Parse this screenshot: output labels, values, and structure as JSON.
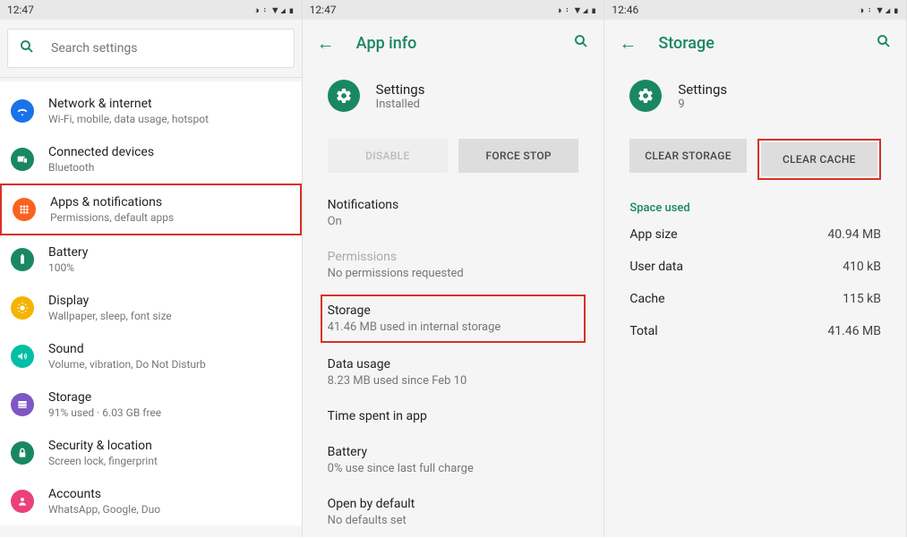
{
  "status": {
    "time1": "12:47",
    "time2": "12:47",
    "time3": "12:46",
    "icons": "◑ ᛬ ▼◢ ▮"
  },
  "panel1": {
    "search_placeholder": "Search settings",
    "items": [
      {
        "title": "Network & internet",
        "sub": "Wi-Fi, mobile, data usage, hotspot",
        "color": "#1a73e8",
        "icon": "wifi"
      },
      {
        "title": "Connected devices",
        "sub": "Bluetooth",
        "color": "#1a8763",
        "icon": "devices"
      },
      {
        "title": "Apps & notifications",
        "sub": "Permissions, default apps",
        "color": "#f9621f",
        "icon": "apps",
        "highlight": true
      },
      {
        "title": "Battery",
        "sub": "100%",
        "color": "#1a8763",
        "icon": "battery"
      },
      {
        "title": "Display",
        "sub": "Wallpaper, sleep, font size",
        "color": "#f4b400",
        "icon": "display"
      },
      {
        "title": "Sound",
        "sub": "Volume, vibration, Do Not Disturb",
        "color": "#00bfa5",
        "icon": "sound"
      },
      {
        "title": "Storage",
        "sub": "91% used · 6.03 GB free",
        "color": "#7e57c2",
        "icon": "storage"
      },
      {
        "title": "Security & location",
        "sub": "Screen lock, fingerprint",
        "color": "#1a8763",
        "icon": "lock"
      },
      {
        "title": "Accounts",
        "sub": "WhatsApp, Google, Duo",
        "color": "#ec407a",
        "icon": "accounts"
      }
    ]
  },
  "panel2": {
    "header": "App info",
    "app_name": "Settings",
    "app_status": "Installed",
    "btn_disable": "DISABLE",
    "btn_force": "FORCE STOP",
    "items": [
      {
        "title": "Notifications",
        "sub": "On"
      },
      {
        "title": "Permissions",
        "sub": "No permissions requested",
        "dim": true
      },
      {
        "title": "Storage",
        "sub": "41.46 MB used in internal storage",
        "highlight": true
      },
      {
        "title": "Data usage",
        "sub": "8.23 MB used since Feb 10"
      },
      {
        "title": "Time spent in app",
        "sub": ""
      },
      {
        "title": "Battery",
        "sub": "0% use since last full charge"
      },
      {
        "title": "Open by default",
        "sub": "No defaults set"
      }
    ]
  },
  "panel3": {
    "header": "Storage",
    "app_name": "Settings",
    "app_status": "9",
    "btn_clear_storage": "CLEAR STORAGE",
    "btn_clear_cache": "CLEAR CACHE",
    "section": "Space used",
    "rows": [
      {
        "k": "App size",
        "v": "40.94 MB"
      },
      {
        "k": "User data",
        "v": "410 kB"
      },
      {
        "k": "Cache",
        "v": "115 kB"
      },
      {
        "k": "Total",
        "v": "41.46 MB"
      }
    ]
  }
}
